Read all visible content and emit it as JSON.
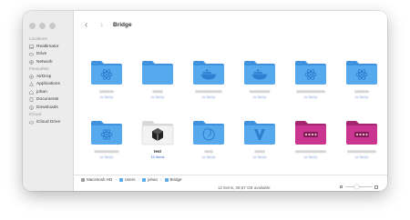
{
  "window": {
    "title": "Bridge"
  },
  "sidebar": {
    "sections": [
      {
        "header": "Locations",
        "items": [
          {
            "label": "Realtimator",
            "icon": "laptop-icon"
          },
          {
            "label": "Drive",
            "icon": "drive-icon"
          },
          {
            "label": "Network",
            "icon": "network-icon"
          }
        ]
      },
      {
        "header": "Favourites",
        "items": [
          {
            "label": "AirDrop",
            "icon": "airdrop-icon"
          },
          {
            "label": "Applications",
            "icon": "applications-icon"
          },
          {
            "label": "johan",
            "icon": "home-icon"
          },
          {
            "label": "Documents",
            "icon": "document-icon"
          },
          {
            "label": "Downloads",
            "icon": "download-icon"
          }
        ]
      },
      {
        "header": "iCloud",
        "items": [
          {
            "label": "iCloud Drive",
            "icon": "cloud-icon"
          }
        ]
      }
    ]
  },
  "toolbar": {
    "back": "‹",
    "forward": "›"
  },
  "items": [
    {
      "name": "xxxxxxx",
      "meta": "xx items",
      "type": "folder",
      "color": "#57a9ee",
      "glyph": "react-icon"
    },
    {
      "name": "xxxxx",
      "meta": "xx items",
      "type": "folder",
      "color": "#57a9ee",
      "glyph": ""
    },
    {
      "name": "xxxxxxxxxxxxx",
      "meta": "xx items",
      "type": "folder",
      "color": "#57a9ee",
      "glyph": "docker-icon"
    },
    {
      "name": "xxxxxxxxxx",
      "meta": "xx items",
      "type": "folder",
      "color": "#57a9ee",
      "glyph": "docker-icon"
    },
    {
      "name": "xxxxxxxxxxxxxx",
      "meta": "xx items",
      "type": "folder",
      "color": "#57a9ee",
      "glyph": "react-icon"
    },
    {
      "name": "xxxxxxx",
      "meta": "xx items",
      "type": "folder",
      "color": "#57a9ee",
      "glyph": "react-icon"
    },
    {
      "name": "xxxxxxxxxxxx",
      "meta": "xx items",
      "type": "folder",
      "color": "#57a9ee",
      "glyph": "react-icon"
    },
    {
      "name": "test",
      "meta": "10 items",
      "type": "folder",
      "color": "#f3f3f3",
      "glyph": "cube-icon"
    },
    {
      "name": "xxxx",
      "meta": "xx items",
      "type": "folder",
      "color": "#57a9ee",
      "glyph": "swirl-icon"
    },
    {
      "name": "xxxxx",
      "meta": "xx items",
      "type": "folder",
      "color": "#57a9ee",
      "glyph": "v-icon"
    },
    {
      "name": "xxxxxxxxxxxxxxx",
      "meta": "xx items",
      "type": "folder",
      "color": "#c9358f",
      "glyph": "dots-icon"
    },
    {
      "name": "xxxxxxxxxxxxxx",
      "meta": "xx items",
      "type": "folder",
      "color": "#c9358f",
      "glyph": "dots-icon"
    }
  ],
  "pathbar": [
    {
      "label": "Macintosh HD",
      "icon": "disk-icon"
    },
    {
      "label": "Users",
      "icon": "folder-icon"
    },
    {
      "label": "johan",
      "icon": "home-icon"
    },
    {
      "label": "Bridge",
      "icon": "folder-icon"
    }
  ],
  "status": {
    "text": "12 items, 39,97 GB available",
    "zoom_level": 0.4
  }
}
